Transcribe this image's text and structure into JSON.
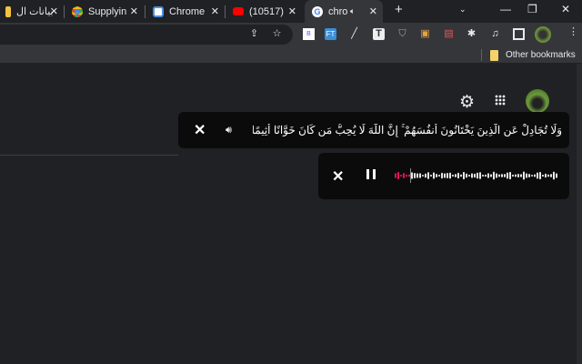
{
  "tabs": [
    {
      "title": "بيانات ال",
      "icon": "doc-icon"
    },
    {
      "title": "Supplyin",
      "icon": "chrome-icon"
    },
    {
      "title": "Chrome",
      "icon": "chrome-extension-icon"
    },
    {
      "title": "(10517)",
      "icon": "youtube-icon"
    },
    {
      "title": "chro",
      "icon": "google-icon",
      "active": true,
      "audio": true
    }
  ],
  "bookmarks": {
    "other": "Other bookmarks"
  },
  "caption": {
    "text": "وَلَا تُجَادِلْ عَنِ الَّذِينَ يَخْتَانُونَ أَنفُسَهُمْ ۚ إِنَّ اللَّهَ لَا يُحِبُّ مَن كَانَ خَوَّانًا أَثِيمًا"
  },
  "media": {
    "state": "playing",
    "progress": 0.1,
    "played_color": "#e8125c"
  },
  "colors": {
    "bg": "#202124",
    "toolbar": "#35363a",
    "panel": "#0b0b0c"
  }
}
